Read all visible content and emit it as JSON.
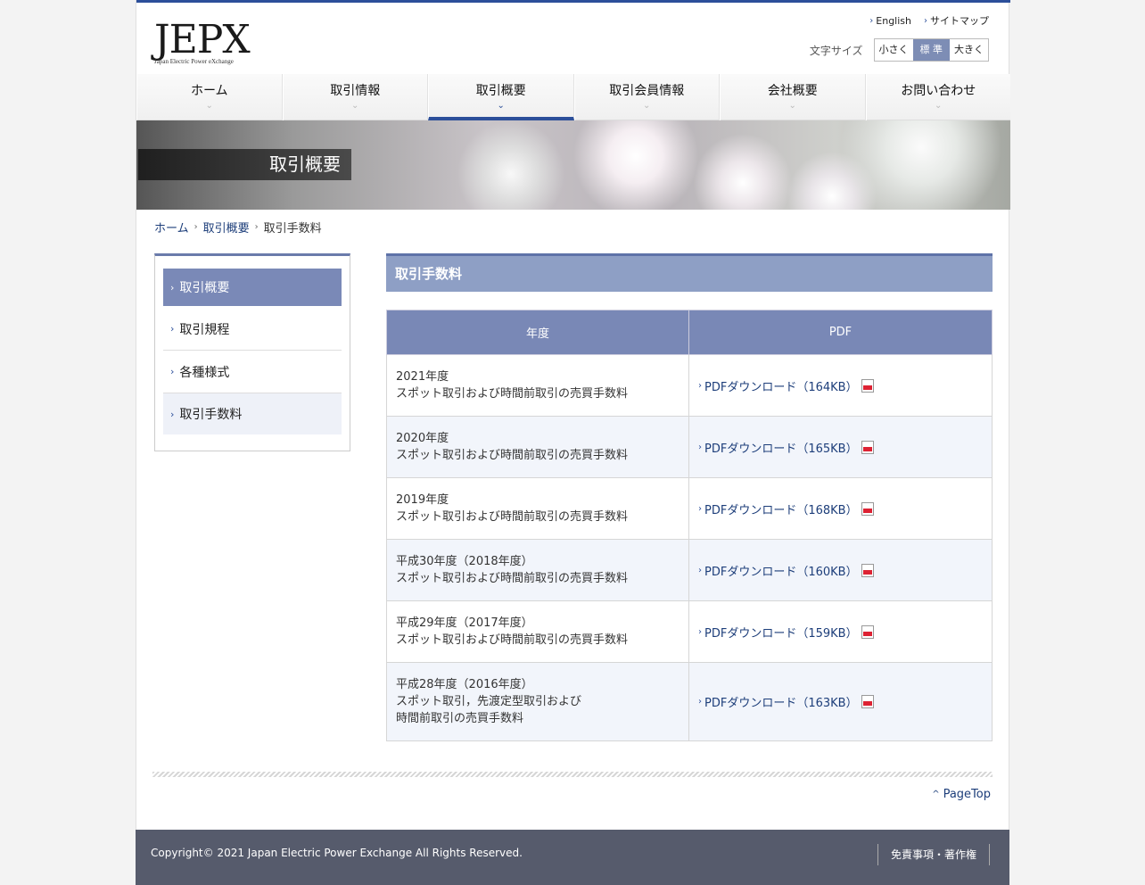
{
  "header": {
    "logo_main": "JEPX",
    "logo_sub": "Japan Electric Power eXchange",
    "util_links": [
      "English",
      "サイトマップ"
    ],
    "fontsize_label": "文字サイズ",
    "fontsize_options": [
      "小さく",
      "標 準",
      "大きく"
    ]
  },
  "gnav": [
    "ホーム",
    "取引情報",
    "取引概要",
    "取引会員情報",
    "会社概要",
    "お問い合わせ"
  ],
  "hero": {
    "title": "取引概要"
  },
  "breadcrumb": {
    "items": [
      "ホーム",
      "取引概要"
    ],
    "current": "取引手数料"
  },
  "sidebar": {
    "items": [
      "取引概要",
      "取引規程",
      "各種様式",
      "取引手数料"
    ]
  },
  "main": {
    "title": "取引手数料",
    "table": {
      "headers": [
        "年度",
        "PDF"
      ],
      "rows": [
        {
          "year": "2021年度",
          "desc1": "スポット取引および時間前取引の売買手数料",
          "desc2": "",
          "pdf": "PDFダウンロード（164KB）"
        },
        {
          "year": "2020年度",
          "desc1": "スポット取引および時間前取引の売買手数料",
          "desc2": "",
          "pdf": "PDFダウンロード（165KB）"
        },
        {
          "year": "2019年度",
          "desc1": "スポット取引および時間前取引の売買手数料",
          "desc2": "",
          "pdf": "PDFダウンロード（168KB）"
        },
        {
          "year": "平成30年度（2018年度）",
          "desc1": "スポット取引および時間前取引の売買手数料",
          "desc2": "",
          "pdf": "PDFダウンロード（160KB）"
        },
        {
          "year": "平成29年度（2017年度）",
          "desc1": "スポット取引および時間前取引の売買手数料",
          "desc2": "",
          "pdf": "PDFダウンロード（159KB）"
        },
        {
          "year": "平成28年度（2016年度）",
          "desc1": "スポット取引，先渡定型取引および",
          "desc2": "時間前取引の売買手数料",
          "pdf": "PDFダウンロード（163KB）"
        }
      ]
    }
  },
  "pagetop": "PageTop",
  "footer": {
    "copyright": "Copyright© 2021 Japan Electric Power Exchange All Rights Reserved.",
    "link": "免責事項・著作権"
  },
  "colors": {
    "accent": "#2c4f9a",
    "table_header": "#7988b6",
    "footer": "#565b6c"
  }
}
